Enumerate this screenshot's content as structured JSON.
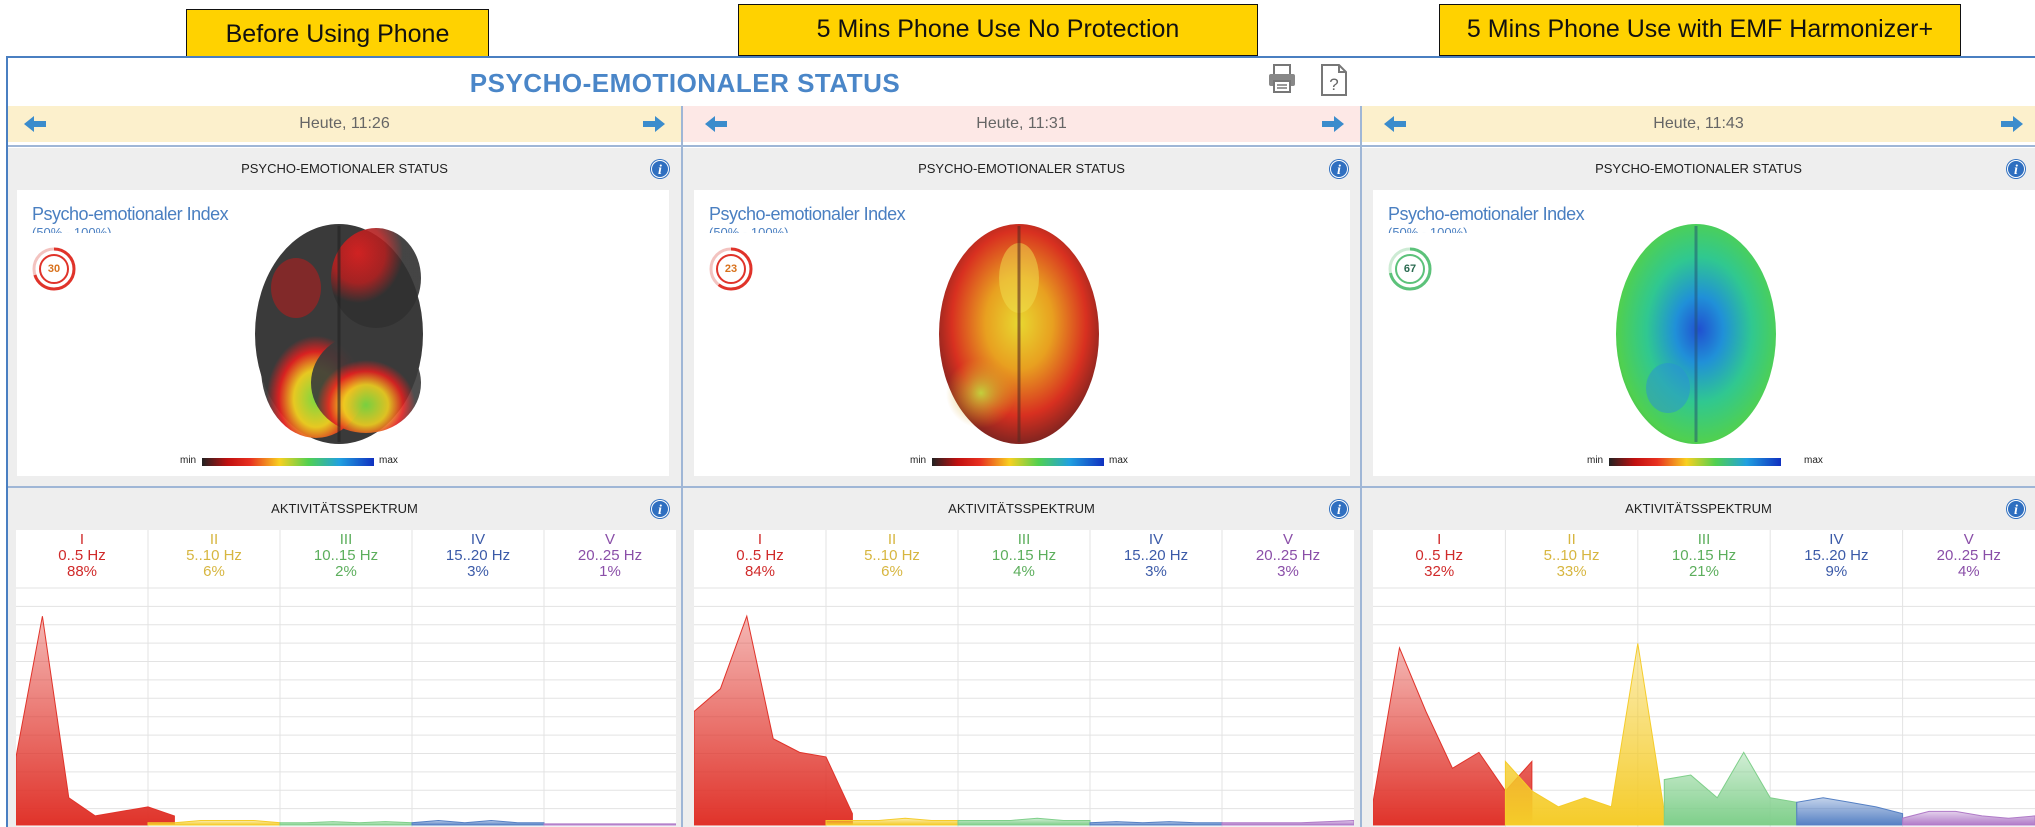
{
  "labels": {
    "before": "Before Using Phone",
    "no_protection": "5 Mins Phone Use No Protection",
    "harmonizer": "5 Mins Phone Use with EMF Harmonizer+"
  },
  "header": {
    "title": "PSYCHO-EMOTIONALER STATUS",
    "print_icon": "printer-icon",
    "help_icon": "help-icon"
  },
  "colors": {
    "band_I": "#e0332a",
    "band_II": "#f5cc2a",
    "band_III": "#7fcf8a",
    "band_IV": "#5580c4",
    "band_V": "#b07ac8",
    "nav_bg_before": "#fcf0cc",
    "nav_bg_no_protection": "#fde8e6",
    "nav_bg_harmonizer": "#fcf0cc",
    "gauge_red": "#e0332a",
    "gauge_green": "#5cc27a"
  },
  "columns": [
    {
      "date": "Heute, 11:26",
      "status_panel_title": "PSYCHO-EMOTIONALER STATUS",
      "index_title": "Psycho-emotionaler Index",
      "index_range": "(50% - 100%)",
      "index_value": "30",
      "scale_min": "min",
      "scale_max": "max",
      "spectrum_title": "AKTIVITÄTSSPEKTRUM",
      "bands": [
        {
          "roman": "I",
          "hz": "0..5 Hz",
          "pct": "88%"
        },
        {
          "roman": "II",
          "hz": "5..10 Hz",
          "pct": "6%"
        },
        {
          "roman": "III",
          "hz": "10..15 Hz",
          "pct": "2%"
        },
        {
          "roman": "IV",
          "hz": "15..20 Hz",
          "pct": "3%"
        },
        {
          "roman": "V",
          "hz": "20..25 Hz",
          "pct": "1%"
        }
      ]
    },
    {
      "date": "Heute, 11:31",
      "status_panel_title": "PSYCHO-EMOTIONALER STATUS",
      "index_title": "Psycho-emotionaler Index",
      "index_range": "(50% - 100%)",
      "index_value": "23",
      "scale_min": "min",
      "scale_max": "max",
      "spectrum_title": "AKTIVITÄTSSPEKTRUM",
      "bands": [
        {
          "roman": "I",
          "hz": "0..5 Hz",
          "pct": "84%"
        },
        {
          "roman": "II",
          "hz": "5..10 Hz",
          "pct": "6%"
        },
        {
          "roman": "III",
          "hz": "10..15 Hz",
          "pct": "4%"
        },
        {
          "roman": "IV",
          "hz": "15..20 Hz",
          "pct": "3%"
        },
        {
          "roman": "V",
          "hz": "20..25 Hz",
          "pct": "3%"
        }
      ]
    },
    {
      "date": "Heute, 11:43",
      "status_panel_title": "PSYCHO-EMOTIONALER STATUS",
      "index_title": "Psycho-emotionaler Index",
      "index_range": "(50% - 100%)",
      "index_value": "67",
      "scale_min": "min",
      "scale_max": "max",
      "spectrum_title": "AKTIVITÄTSSPEKTRUM",
      "bands": [
        {
          "roman": "I",
          "hz": "0..5 Hz",
          "pct": "32%"
        },
        {
          "roman": "II",
          "hz": "5..10 Hz",
          "pct": "33%"
        },
        {
          "roman": "III",
          "hz": "10..15 Hz",
          "pct": "21%"
        },
        {
          "roman": "IV",
          "hz": "15..20 Hz",
          "pct": "9%"
        },
        {
          "roman": "V",
          "hz": "20..25 Hz",
          "pct": "4%"
        }
      ]
    }
  ],
  "chart_data": [
    {
      "type": "area",
      "title": "AKTIVITÄTSSPEKTRUM",
      "x": [
        0,
        1,
        2,
        3,
        4,
        5,
        6,
        7,
        8,
        9,
        10,
        11,
        12,
        13,
        14,
        15,
        16,
        17,
        18,
        19,
        20,
        21,
        22,
        23,
        24,
        25
      ],
      "series": [
        {
          "name": "I",
          "color": "#e0332a",
          "values": [
            0.3,
            0.92,
            0.12,
            0.04,
            0.06,
            0.08,
            0.04,
            null,
            null,
            null,
            null,
            null,
            null,
            null,
            null,
            null,
            null,
            null,
            null,
            null,
            null,
            null,
            null,
            null,
            null,
            null
          ]
        },
        {
          "name": "II",
          "color": "#f5cc2a",
          "values": [
            null,
            null,
            null,
            null,
            null,
            0.01,
            0.01,
            0.02,
            0.02,
            0.02,
            0.01,
            null,
            null,
            null,
            null,
            null,
            null,
            null,
            null,
            null,
            null,
            null,
            null,
            null,
            null,
            null
          ]
        },
        {
          "name": "III",
          "color": "#7fcf8a",
          "values": [
            null,
            null,
            null,
            null,
            null,
            null,
            null,
            null,
            null,
            null,
            0.01,
            0.01,
            0.015,
            0.01,
            0.015,
            0.01,
            null,
            null,
            null,
            null,
            null,
            null,
            null,
            null,
            null,
            null
          ]
        },
        {
          "name": "IV",
          "color": "#5580c4",
          "values": [
            null,
            null,
            null,
            null,
            null,
            null,
            null,
            null,
            null,
            null,
            null,
            null,
            null,
            null,
            null,
            0.01,
            0.02,
            0.01,
            0.02,
            0.01,
            0.01,
            null,
            null,
            null,
            null,
            null
          ]
        },
        {
          "name": "V",
          "color": "#b07ac8",
          "values": [
            null,
            null,
            null,
            null,
            null,
            null,
            null,
            null,
            null,
            null,
            null,
            null,
            null,
            null,
            null,
            null,
            null,
            null,
            null,
            null,
            0.005,
            0.005,
            0.005,
            0.005,
            0.005,
            0.005
          ]
        }
      ]
    },
    {
      "type": "area",
      "title": "AKTIVITÄTSSPEKTRUM",
      "x": [
        0,
        1,
        2,
        3,
        4,
        5,
        6,
        7,
        8,
        9,
        10,
        11,
        12,
        13,
        14,
        15,
        16,
        17,
        18,
        19,
        20,
        21,
        22,
        23,
        24,
        25
      ],
      "series": [
        {
          "name": "I",
          "color": "#e0332a",
          "values": [
            0.5,
            0.6,
            0.92,
            0.38,
            0.32,
            0.3,
            0.05,
            null,
            null,
            null,
            null,
            null,
            null,
            null,
            null,
            null,
            null,
            null,
            null,
            null,
            null,
            null,
            null,
            null,
            null,
            null
          ]
        },
        {
          "name": "II",
          "color": "#f5cc2a",
          "values": [
            null,
            null,
            null,
            null,
            null,
            0.02,
            0.02,
            0.02,
            0.03,
            0.02,
            0.02,
            null,
            null,
            null,
            null,
            null,
            null,
            null,
            null,
            null,
            null,
            null,
            null,
            null,
            null,
            null
          ]
        },
        {
          "name": "III",
          "color": "#7fcf8a",
          "values": [
            null,
            null,
            null,
            null,
            null,
            null,
            null,
            null,
            null,
            null,
            0.02,
            0.02,
            0.02,
            0.03,
            0.02,
            0.02,
            null,
            null,
            null,
            null,
            null,
            null,
            null,
            null,
            null,
            null
          ]
        },
        {
          "name": "IV",
          "color": "#5580c4",
          "values": [
            null,
            null,
            null,
            null,
            null,
            null,
            null,
            null,
            null,
            null,
            null,
            null,
            null,
            null,
            null,
            0.01,
            0.015,
            0.01,
            0.015,
            0.01,
            0.01,
            null,
            null,
            null,
            null,
            null
          ]
        },
        {
          "name": "V",
          "color": "#b07ac8",
          "values": [
            null,
            null,
            null,
            null,
            null,
            null,
            null,
            null,
            null,
            null,
            null,
            null,
            null,
            null,
            null,
            null,
            null,
            null,
            null,
            null,
            0.01,
            0.01,
            0.01,
            0.01,
            0.015,
            0.02
          ]
        }
      ]
    },
    {
      "type": "area",
      "title": "AKTIVITÄTSSPEKTRUM",
      "x": [
        0,
        1,
        2,
        3,
        4,
        5,
        6,
        7,
        8,
        9,
        10,
        11,
        12,
        13,
        14,
        15,
        16,
        17,
        18,
        19,
        20,
        21,
        22,
        23,
        24,
        25
      ],
      "series": [
        {
          "name": "I",
          "color": "#e0332a",
          "values": [
            0.1,
            0.78,
            0.5,
            0.25,
            0.32,
            0.15,
            0.28,
            null,
            null,
            null,
            null,
            null,
            null,
            null,
            null,
            null,
            null,
            null,
            null,
            null,
            null,
            null,
            null,
            null,
            null,
            null
          ]
        },
        {
          "name": "II",
          "color": "#f5cc2a",
          "values": [
            null,
            null,
            null,
            null,
            null,
            0.28,
            0.15,
            0.08,
            0.12,
            0.08,
            0.8,
            0.06,
            null,
            null,
            null,
            null,
            null,
            null,
            null,
            null,
            null,
            null,
            null,
            null,
            null,
            null
          ]
        },
        {
          "name": "III",
          "color": "#7fcf8a",
          "values": [
            null,
            null,
            null,
            null,
            null,
            null,
            null,
            null,
            null,
            null,
            null,
            0.2,
            0.22,
            0.12,
            0.32,
            0.12,
            0.1,
            null,
            null,
            null,
            null,
            null,
            null,
            null,
            null,
            null
          ]
        },
        {
          "name": "IV",
          "color": "#5580c4",
          "values": [
            null,
            null,
            null,
            null,
            null,
            null,
            null,
            null,
            null,
            null,
            null,
            null,
            null,
            null,
            null,
            null,
            0.1,
            0.12,
            0.1,
            0.08,
            0.05,
            null,
            null,
            null,
            null,
            null
          ]
        },
        {
          "name": "V",
          "color": "#b07ac8",
          "values": [
            null,
            null,
            null,
            null,
            null,
            null,
            null,
            null,
            null,
            null,
            null,
            null,
            null,
            null,
            null,
            null,
            null,
            null,
            null,
            null,
            0.03,
            0.06,
            0.06,
            0.04,
            0.03,
            0.04
          ]
        }
      ]
    }
  ]
}
